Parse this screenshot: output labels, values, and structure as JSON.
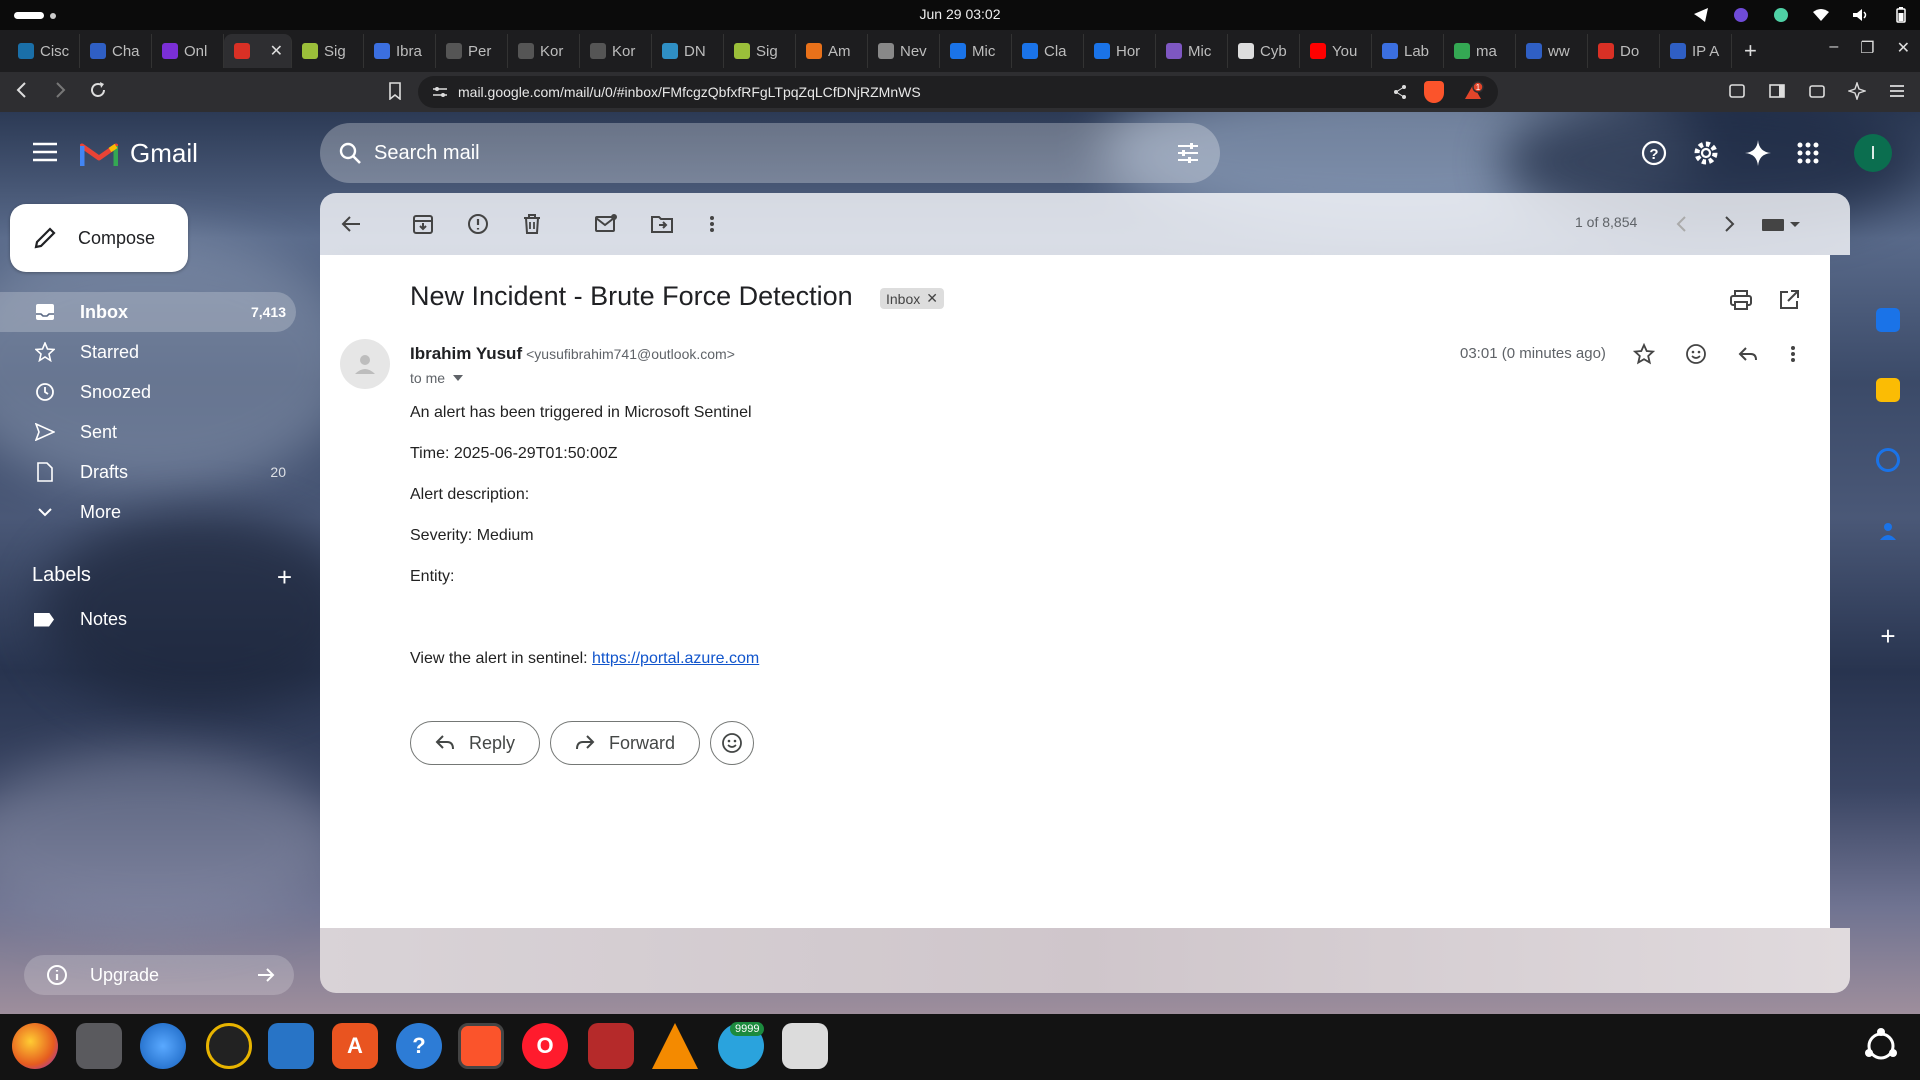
{
  "os": {
    "clock": "Jun 29  03:02"
  },
  "tabs": [
    {
      "label": "Cisc",
      "color": "#1a6fa8"
    },
    {
      "label": "Cha",
      "color": "#2f5fc4"
    },
    {
      "label": "Onl",
      "color": "#7b2fd6"
    },
    {
      "label": "",
      "color": "#d93025",
      "active": true
    },
    {
      "label": "Sig",
      "color": "#9bbf3a"
    },
    {
      "label": "Ibra",
      "color": "#3b6fe0"
    },
    {
      "label": "Per",
      "color": "#555555"
    },
    {
      "label": "Kor",
      "color": "#555555"
    },
    {
      "label": "Kor",
      "color": "#555555"
    },
    {
      "label": "DN",
      "color": "#2f8fc4"
    },
    {
      "label": "Sig",
      "color": "#9bbf3a"
    },
    {
      "label": "Am",
      "color": "#e8711a"
    },
    {
      "label": "Nev",
      "color": "#888888"
    },
    {
      "label": "Mic",
      "color": "#1a73e8"
    },
    {
      "label": "Cla",
      "color": "#1a73e8"
    },
    {
      "label": "Hor",
      "color": "#1a73e8"
    },
    {
      "label": "Mic",
      "color": "#7e57c2"
    },
    {
      "label": "Cyb",
      "color": "#dddddd"
    },
    {
      "label": "You",
      "color": "#ff0000"
    },
    {
      "label": "Lab",
      "color": "#3b6fe0"
    },
    {
      "label": "ma",
      "color": "#34a853"
    },
    {
      "label": "ww",
      "color": "#2f5fc4"
    },
    {
      "label": "Do",
      "color": "#d93025"
    },
    {
      "label": "IP A",
      "color": "#2f5fc4"
    }
  ],
  "browser": {
    "url": "mail.google.com/mail/u/0/#inbox/FMfcgzQbfxfRFgLTpqZqLCfDNjRZMnWS",
    "rewards_count": "1"
  },
  "gmail": {
    "brand": "Gmail",
    "search_placeholder": "Search mail",
    "avatar_letter": "I",
    "compose": "Compose",
    "nav": [
      {
        "label": "Inbox",
        "count": "7,413",
        "icon": "inbox-icon",
        "active": true
      },
      {
        "label": "Starred",
        "count": "",
        "icon": "star-icon"
      },
      {
        "label": "Snoozed",
        "count": "",
        "icon": "clock-icon"
      },
      {
        "label": "Sent",
        "count": "",
        "icon": "send-icon"
      },
      {
        "label": "Drafts",
        "count": "20",
        "icon": "draft-icon"
      },
      {
        "label": "More",
        "count": "",
        "icon": "chevron-down-icon"
      }
    ],
    "labels_title": "Labels",
    "labels": [
      "Notes"
    ],
    "upgrade": "Upgrade",
    "pagination": "1 of 8,854"
  },
  "email": {
    "subject": "New Incident - Brute Force Detection",
    "tag": "Inbox",
    "sender_name": "Ibrahim Yusuf",
    "sender_email": "<yusufibrahim741@outlook.com>",
    "to": "to me",
    "time": "03:01 (0 minutes ago)",
    "body": {
      "line1": "An alert has been triggered in Microsoft Sentinel",
      "line2": "Time: 2025-06-29T01:50:00Z",
      "line3": "Alert description:",
      "line4": "Severity: Medium",
      "line5": "Entity:",
      "link_prefix": "View the alert in sentinel: ",
      "link_text": "https://portal.azure.com"
    },
    "reply": "Reply",
    "forward": "Forward"
  },
  "dock": {
    "telegram_badge": "9999"
  },
  "colors": {
    "gmail_red": "#ea4335",
    "link": "#1155cc",
    "avatar_bg": "#0b6e4f"
  }
}
